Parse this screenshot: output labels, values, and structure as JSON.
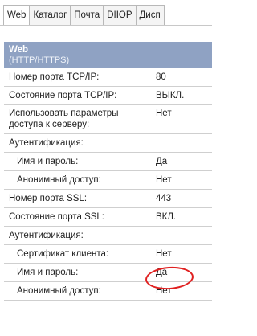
{
  "tabs": [
    "Web",
    "Каталог",
    "Почта",
    "DIIOP",
    "Дисп"
  ],
  "section": {
    "title": "Web",
    "subtitle": "(HTTP/HTTPS)"
  },
  "rows": [
    {
      "label": "Номер порта TCP/IP:",
      "value": "80"
    },
    {
      "label": "Состояние порта TCP/IP:",
      "value": "ВЫКЛ."
    },
    {
      "label": "Использовать параметры доступа к серверу:",
      "value": "Нет"
    },
    {
      "label": "Аутентификация:",
      "value": ""
    },
    {
      "label": "Имя и пароль:",
      "value": "Да"
    },
    {
      "label": "Анонимный доступ:",
      "value": "Нет"
    },
    {
      "label": "Номер порта SSL:",
      "value": "443"
    },
    {
      "label": "Состояние порта SSL:",
      "value": "ВКЛ."
    },
    {
      "label": "Аутентификация:",
      "value": ""
    },
    {
      "label": "Сертификат клиента:",
      "value": "Нет"
    },
    {
      "label": "Имя и пароль:",
      "value": "Да"
    },
    {
      "label": "Анонимный доступ:",
      "value": "Нет"
    }
  ],
  "colors": {
    "header_bg": "#8fa2c3",
    "highlight": "#e02020"
  }
}
